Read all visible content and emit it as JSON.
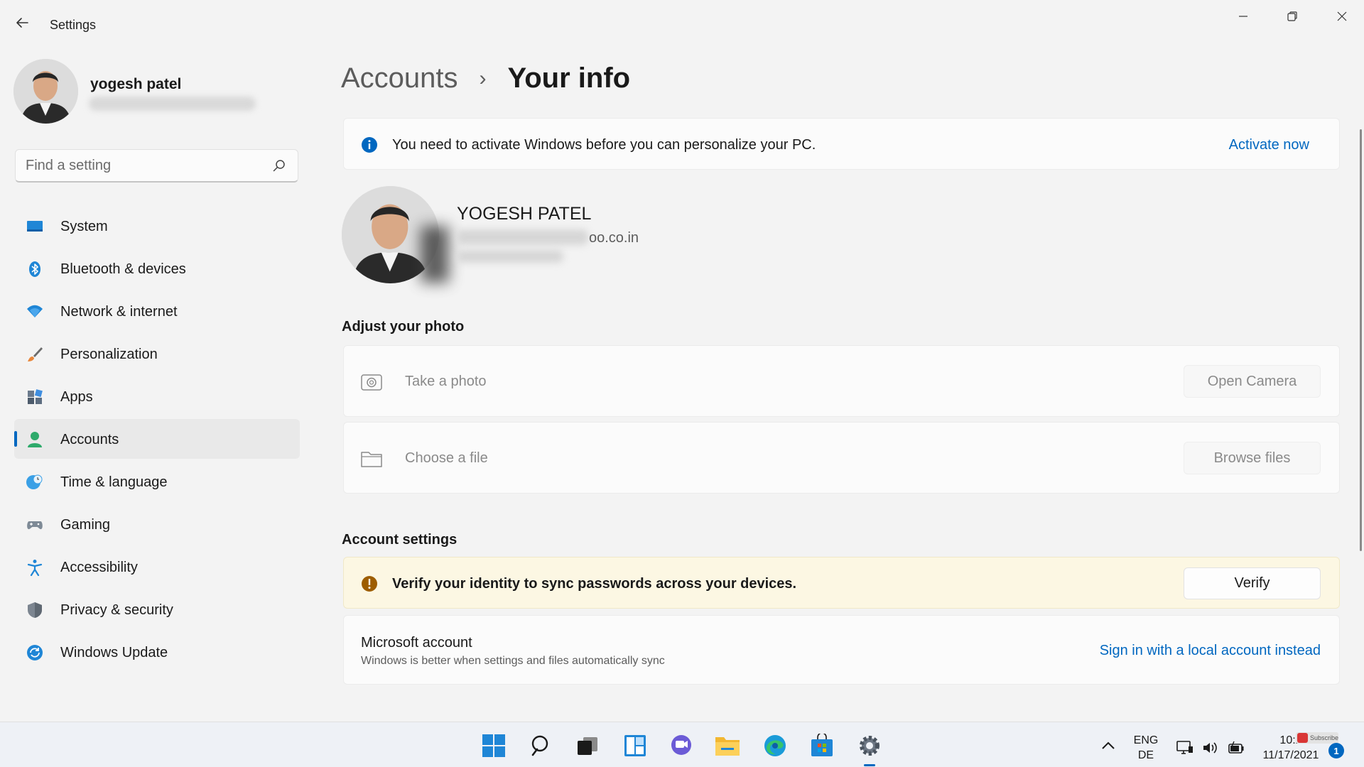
{
  "window": {
    "title": "Settings",
    "back_icon": "back-arrow-icon",
    "controls": [
      "minimize-icon",
      "restore-icon",
      "close-icon"
    ]
  },
  "profile": {
    "name": "yogesh patel"
  },
  "search": {
    "placeholder": "Find a setting",
    "value": ""
  },
  "sidebar": {
    "items": [
      {
        "label": "System",
        "icon": "system-monitor-icon",
        "active": false
      },
      {
        "label": "Bluetooth & devices",
        "icon": "bluetooth-icon",
        "active": false
      },
      {
        "label": "Network & internet",
        "icon": "wifi-icon",
        "active": false
      },
      {
        "label": "Personalization",
        "icon": "paintbrush-icon",
        "active": false
      },
      {
        "label": "Apps",
        "icon": "apps-icon",
        "active": false
      },
      {
        "label": "Accounts",
        "icon": "person-icon",
        "active": true
      },
      {
        "label": "Time & language",
        "icon": "globe-clock-icon",
        "active": false
      },
      {
        "label": "Gaming",
        "icon": "gamepad-icon",
        "active": false
      },
      {
        "label": "Accessibility",
        "icon": "accessibility-icon",
        "active": false
      },
      {
        "label": "Privacy & security",
        "icon": "shield-icon",
        "active": false
      },
      {
        "label": "Windows Update",
        "icon": "update-icon",
        "active": false
      }
    ]
  },
  "breadcrumb": {
    "parent": "Accounts",
    "separator": "›",
    "current": "Your info"
  },
  "activation_banner": {
    "text": "You need to activate Windows before you can personalize your PC.",
    "link": "Activate now"
  },
  "user": {
    "display_name": "YOGESH PATEL",
    "email_visible_part": "oo.co.in"
  },
  "adjust_photo": {
    "title": "Adjust your photo",
    "take_photo": {
      "label": "Take a photo",
      "button": "Open Camera"
    },
    "choose_file": {
      "label": "Choose a file",
      "button": "Browse files"
    }
  },
  "account_settings": {
    "title": "Account settings",
    "verify": {
      "text": "Verify your identity to sync passwords across your devices.",
      "button": "Verify"
    },
    "microsoft_account": {
      "title": "Microsoft account",
      "subtitle": "Windows is better when settings and files automatically sync",
      "link": "Sign in with a local account instead"
    }
  },
  "taskbar": {
    "icons": [
      "windows-start-icon",
      "search-icon",
      "task-view-icon",
      "widgets-icon",
      "chat-icon",
      "file-explorer-icon",
      "edge-icon",
      "store-icon",
      "settings-gear-icon"
    ],
    "tray": {
      "lang_line1": "ENG",
      "lang_line2": "DE",
      "time": "10:2",
      "date": "11/17/2021",
      "badge_text": "Subscribe",
      "notification_count": "1"
    }
  },
  "colors": {
    "accent": "#0067c0",
    "background": "#f3f3f3",
    "card": "#fbfbfb",
    "warning_bg": "#fcf7e3"
  }
}
